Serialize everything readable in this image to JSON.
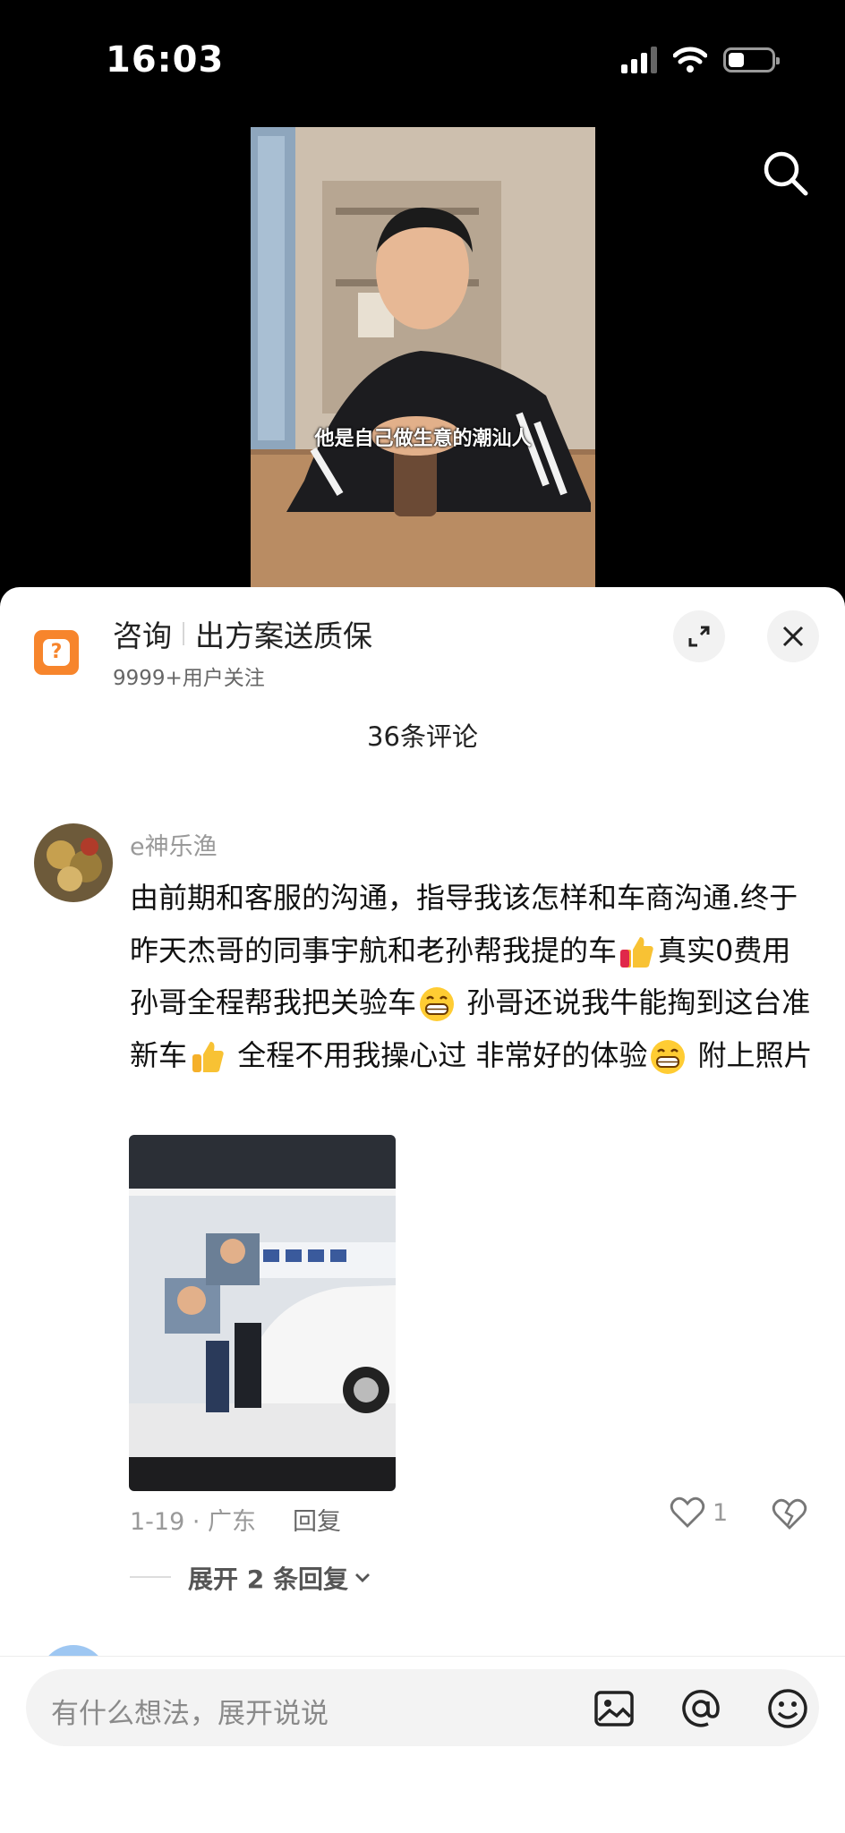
{
  "status_bar": {
    "time": "16:03",
    "battery_level": 0.3
  },
  "video": {
    "subtitle": "他是自己做生意的潮汕人"
  },
  "icons": {
    "search": "search-icon",
    "expand": "expand-icon",
    "close": "close-icon",
    "question": "question-icon",
    "image": "image-icon",
    "at": "at-icon",
    "emoji": "emoji-icon",
    "heart": "heart-icon",
    "broken_heart": "broken-heart-icon",
    "chevron": "chevron-down-icon"
  },
  "promo": {
    "title_left": "咨询",
    "title_right": "出方案送质保",
    "subtitle": "9999+用户关注",
    "accent_color": "#f7852c"
  },
  "comments_header": {
    "count_label": "36条评论"
  },
  "comment": {
    "username": "e神乐渔",
    "text_1": "由前期和客服的沟通，指导我该怎样和车商沟通.终于昨天杰哥的同事宇航和老孙帮我提的车",
    "text_2": "真实0费用 孙哥全程帮我把关验车",
    "text_3": " 孙哥还说我牛能掏到这台准新车",
    "text_4": " 全程不用我操心过 非常好的体验",
    "text_5": " 附上照片",
    "date_location": "1-19 · 广东",
    "reply_label": "回复",
    "like_count": "1",
    "expand_replies": "展开 2 条回复"
  },
  "input": {
    "placeholder": "有什么想法，展开说说"
  }
}
